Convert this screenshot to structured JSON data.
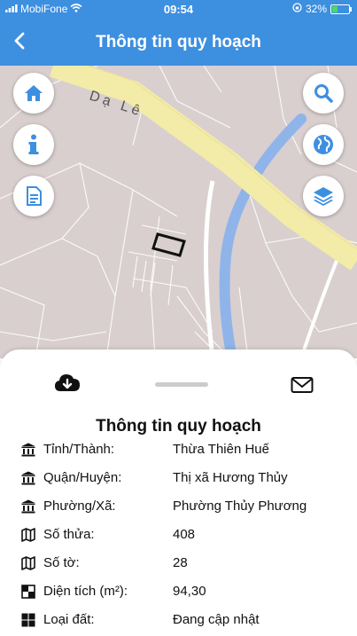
{
  "status": {
    "carrier": "MobiFone",
    "time": "09:54",
    "battery": "32%",
    "battery_level": 0.32
  },
  "header": {
    "title": "Thông tin quy hoạch"
  },
  "map": {
    "road_label": "Dạ Lê"
  },
  "sheet": {
    "title": "Thông tin quy hoạch",
    "rows": [
      {
        "icon": "bank-icon",
        "label": "Tỉnh/Thành:",
        "value": "Thừa Thiên Huế"
      },
      {
        "icon": "bank-icon",
        "label": "Quận/Huyện:",
        "value": "Thị xã Hương Thủy"
      },
      {
        "icon": "bank-icon",
        "label": "Phường/Xã:",
        "value": "Phường Thủy Phương"
      },
      {
        "icon": "map-icon",
        "label": "Số thửa:",
        "value": "408"
      },
      {
        "icon": "map-icon",
        "label": "Số tờ:",
        "value": "28"
      },
      {
        "icon": "area-icon",
        "label": "Diện tích (m²):",
        "value": "94,30"
      },
      {
        "icon": "grid-icon",
        "label": "Loại đất:",
        "value": "Đang cập nhật"
      }
    ]
  },
  "colors": {
    "header": "#3d8fe0",
    "accent": "#3d8fe0",
    "map_bg": "#d9cfcf",
    "road": "#f3eba8",
    "river": "#8fb4ea"
  }
}
